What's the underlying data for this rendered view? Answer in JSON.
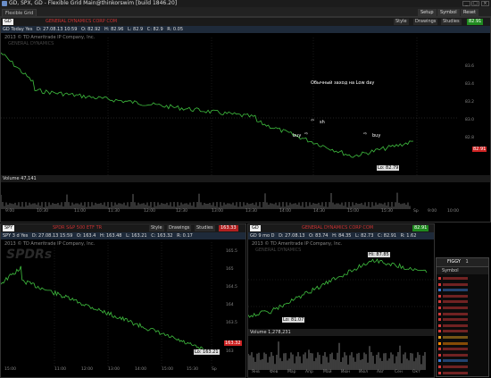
{
  "app": {
    "title": "GD, SPX, GD - Flexible Grid Main@thinkorswim [build 1846.20]",
    "controls": {
      "setup": "Setup",
      "symbol": "Symbol",
      "reset": "Reset"
    },
    "tab": "Flexible Grid"
  },
  "top_chart": {
    "symbol": "GD",
    "description": "GENERAL DYNAMICS CORP COM",
    "price": "82.91",
    "quote_row": [
      "GD Today Yes",
      "D: 27.08.13 10:59",
      "O: 82.92",
      "H: 82.96",
      "L: 82.9",
      "C: 82.9",
      "R: 0.05"
    ],
    "copyright": "2013 © TD Ameritrade IP Company, Inc.",
    "watermark_text": "GENERAL DYNAMICS",
    "annotation": "Обычный заход на Low day",
    "labels": {
      "sh": "sh",
      "buy_left": "buy",
      "buy_right": "buy"
    },
    "low_label": "Lo: 82.79",
    "last_price_badge": "82.91",
    "y_ticks": [
      "83.6",
      "83.4",
      "83.2",
      "83.0",
      "82.8"
    ],
    "x_ticks": [
      "9:00",
      "10:30",
      "11:00",
      "11:30",
      "12:00",
      "12:30",
      "13:00",
      "13:30",
      "14:00",
      "14:30",
      "15:00",
      "15:30",
      "Sp",
      "9:00",
      "10:00"
    ],
    "volume_label": "Volume  47,141",
    "controls": {
      "style": "Style",
      "drawings": "Drawings",
      "studies": "Studies"
    }
  },
  "bottom_left_chart": {
    "symbol": "SPY",
    "description": "SPDR S&P 500 ETF TR",
    "price": "163.33",
    "quote_row": [
      "SPY 3 d Yes",
      "D: 27.08.13 15:59",
      "O: 163.4",
      "H: 163.48",
      "L: 163.21",
      "C: 163.32",
      "R: 0.17"
    ],
    "copyright": "2013 © TD Ameritrade IP Company, Inc.",
    "watermark_text": "SPDRs",
    "low_label": "Lo: 163.21",
    "last_price_badge": "163.32",
    "y_ticks": [
      "165.5",
      "165",
      "164.5",
      "164",
      "163.5",
      "163"
    ],
    "x_ticks": [
      "15:00",
      "11:00",
      "12:00",
      "13:00",
      "14:00",
      "15:00",
      "15:30",
      "Sp"
    ],
    "controls": {
      "style": "Style",
      "drawings": "Drawings",
      "studies": "Studies"
    }
  },
  "bottom_right_chart": {
    "symbol": "GD",
    "description": "GENERAL DYNAMICS CORP COM",
    "price": "82.91",
    "quote_row": [
      "GD 9 mo D",
      "D: 27.08.13",
      "O: 83.74",
      "H: 84.35",
      "L: 82.73",
      "C: 82.91",
      "R: 1.62"
    ],
    "copyright": "2013 © TD Ameritrade IP Company, Inc.",
    "watermark_text": "GENERAL DYNAMICS",
    "high_label": "Hi: 87.85",
    "low_label": "Lo: 81.07",
    "volume_label": "Volume  1,278,231",
    "x_ticks": [
      "Янв",
      "Фев",
      "Мар",
      "Апр",
      "Май",
      "Июн",
      "Июл",
      "Авг",
      "Сен",
      "Окт"
    ],
    "controls": {
      "style": "Style",
      "drawings": "Drawings",
      "studies": "Studies"
    }
  },
  "watchlist": {
    "title": "FIGGY",
    "group_number": "1",
    "header": "Symbol",
    "items": [
      {
        "color": "#d63a3a"
      },
      {
        "color": "#d63a3a"
      },
      {
        "color": "#3a7bd6"
      },
      {
        "color": "#d63a3a"
      },
      {
        "color": "#d63a3a"
      },
      {
        "color": "#d63a3a"
      },
      {
        "color": "#d63a3a"
      },
      {
        "color": "#d63a3a"
      },
      {
        "color": "#d63a3a"
      },
      {
        "color": "#d63a3a"
      },
      {
        "color": "#e0a020"
      },
      {
        "color": "#ff8c00"
      },
      {
        "color": "#d63a3a"
      },
      {
        "color": "#d63a3a"
      },
      {
        "color": "#3a7bd6"
      },
      {
        "color": "#d63a3a"
      },
      {
        "color": "#d63a3a"
      }
    ]
  },
  "colors": {
    "up": "#3fbf3f",
    "down": "#e33b3b",
    "accent": "#3a7bd6"
  }
}
